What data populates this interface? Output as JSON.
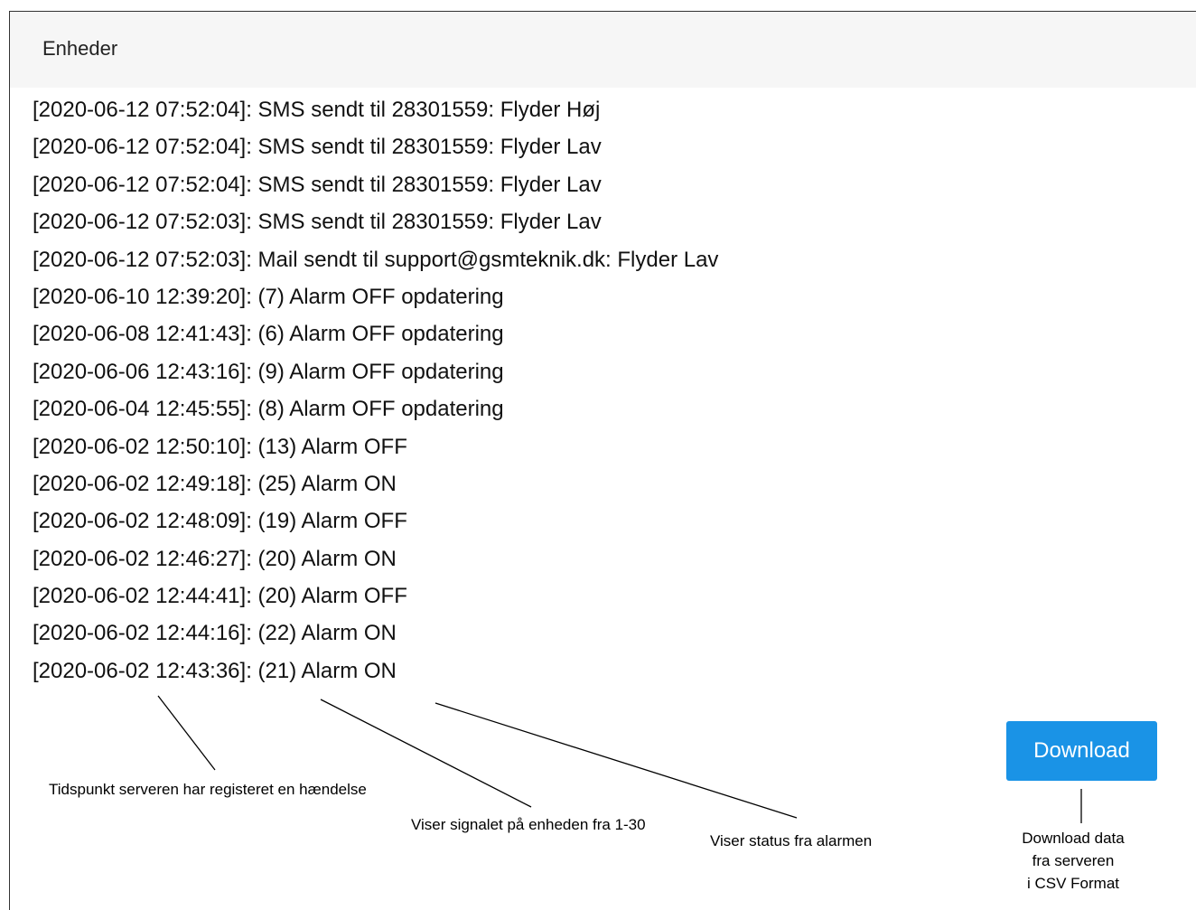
{
  "panel": {
    "title": "Enheder"
  },
  "log_entries": [
    "[2020-06-12 07:52:04]: SMS sendt til 28301559: Flyder Høj",
    "[2020-06-12 07:52:04]: SMS sendt til 28301559: Flyder Lav",
    "[2020-06-12 07:52:04]: SMS sendt til 28301559: Flyder Lav",
    "[2020-06-12 07:52:03]: SMS sendt til 28301559: Flyder Lav",
    "[2020-06-12 07:52:03]: Mail sendt til support@gsmteknik.dk: Flyder Lav",
    "[2020-06-10 12:39:20]: (7) Alarm OFF opdatering",
    "[2020-06-08 12:41:43]: (6) Alarm OFF opdatering",
    "[2020-06-06 12:43:16]: (9) Alarm OFF opdatering",
    "[2020-06-04 12:45:55]: (8) Alarm OFF opdatering",
    "[2020-06-02 12:50:10]: (13) Alarm OFF",
    "[2020-06-02 12:49:18]: (25) Alarm ON",
    "[2020-06-02 12:48:09]: (19) Alarm OFF",
    "[2020-06-02 12:46:27]: (20) Alarm ON",
    "[2020-06-02 12:44:41]: (20) Alarm OFF",
    "[2020-06-02 12:44:16]: (22) Alarm ON",
    "[2020-06-02 12:43:36]: (21) Alarm ON"
  ],
  "download_button": {
    "label": "Download"
  },
  "annotations": {
    "timestamp": "Tidspunkt serveren har registeret en hændelse",
    "signal": "Viser signalet på enheden fra 1-30",
    "status": "Viser status fra alarmen",
    "download_lines": [
      "Download data",
      "fra serveren",
      "i CSV Format"
    ]
  },
  "colors": {
    "accent": "#1a93e6",
    "header_background": "#f6f6f6"
  }
}
